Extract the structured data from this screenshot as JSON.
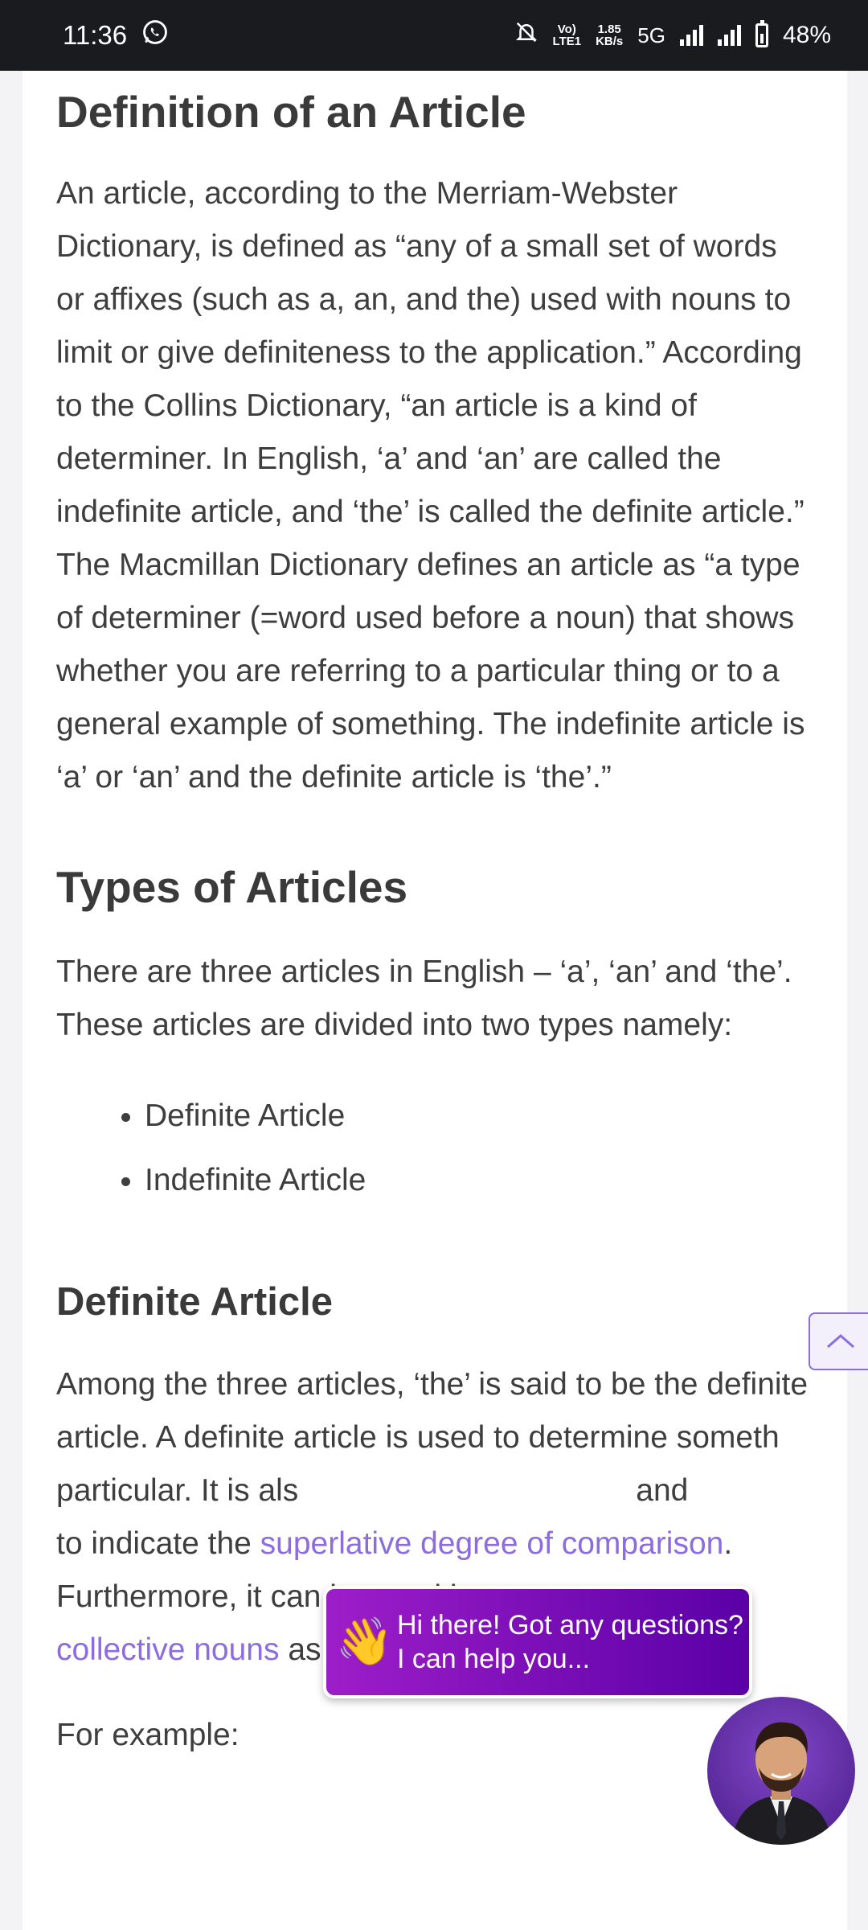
{
  "status_bar": {
    "time": "11:36",
    "network_top": "Vo)",
    "network_bottom": "LTE1",
    "speed_value": "1.85",
    "speed_unit": "KB/s",
    "network_type": "5G",
    "battery": "48%"
  },
  "article": {
    "heading_definition": "Definition of an Article",
    "paragraph_definition": "An article, according to the Merriam-Webster Dictionary, is defined as “any of a small set of words or affixes (such as a, an, and the) used with nouns to limit or give definiteness to the application.” According to the Collins Dictionary, “an article is a kind of determiner. In English, ‘a’ and ‘an’ are called the indefinite article, and ‘the’ is called the definite article.” The Macmillan Dictionary defines an article as “a type of determiner (=word used before a noun) that shows whether you are referring to a particular thing or to a general example of something. The indefinite article is ‘a’ or ‘an’ and the definite article is ‘the’.”",
    "heading_types": "Types of Articles",
    "paragraph_types": "There are three articles in English – ‘a’, ‘an’ and ‘the’. These articles are divided into two types namely:",
    "types_list": [
      "Definite Article",
      "Indefinite Article"
    ],
    "heading_definite": "Definite Article",
    "paragraph_definite_1": "Among the three articles, ‘the’ is said to be the definite article. A definite article is used to determine someth",
    "paragraph_definite_2": "particular. It is als",
    "paragraph_definite_3": "and",
    "paragraph_definite_4": "to indicate the ",
    "link_superlative": "superlative degree of comparison",
    "paragraph_definite_5": ". Furthermore, it can be used b",
    "link_collective": "collective nouns",
    "paragraph_definite_6": " as well.",
    "for_example": "For example:"
  },
  "chat": {
    "line1": "Hi there! Got any questions?",
    "line2": "I can help you..."
  },
  "icons": {
    "scroll_top": "chevron-up-icon",
    "wave": "waving-hand-icon"
  },
  "colors": {
    "link": "#8c6ce0",
    "chat_start": "#9d1ec9",
    "chat_end": "#5a00a6"
  }
}
